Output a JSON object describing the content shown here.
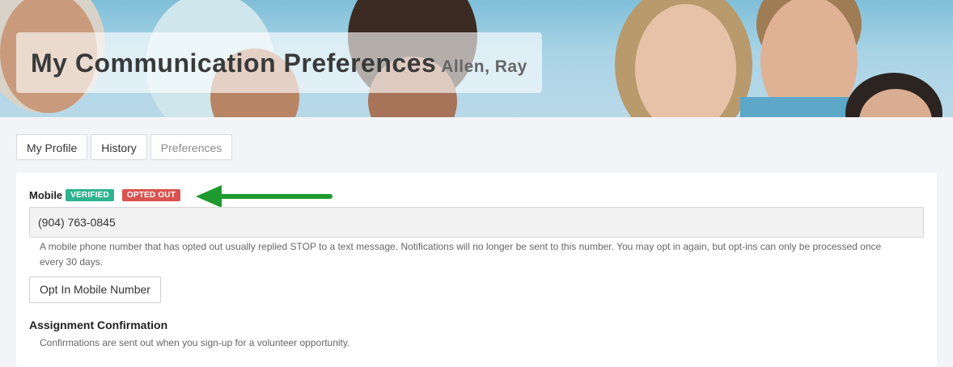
{
  "header": {
    "title": "My Communication Preferences",
    "subtitle": "Allen, Ray"
  },
  "tabs": [
    {
      "label": "My Profile"
    },
    {
      "label": "History"
    },
    {
      "label": "Preferences"
    }
  ],
  "mobile": {
    "label": "Mobile",
    "badge_verified": "VERIFIED",
    "badge_opted_out": "OPTED OUT",
    "value": "(904) 763-0845",
    "help_text": "A mobile phone number that has opted out usually replied STOP to a text message. Notifications will no longer be sent to this number. You may opt in again, but opt-ins can only be processed once every 30 days.",
    "button_label": "Opt In Mobile Number"
  },
  "assignment_confirmation": {
    "title": "Assignment Confirmation",
    "help_text": "Confirmations are sent out when you sign-up for a volunteer opportunity."
  },
  "colors": {
    "verified": "#2db48e",
    "opted_out": "#d9534f",
    "arrow": "#1e9a2e"
  }
}
